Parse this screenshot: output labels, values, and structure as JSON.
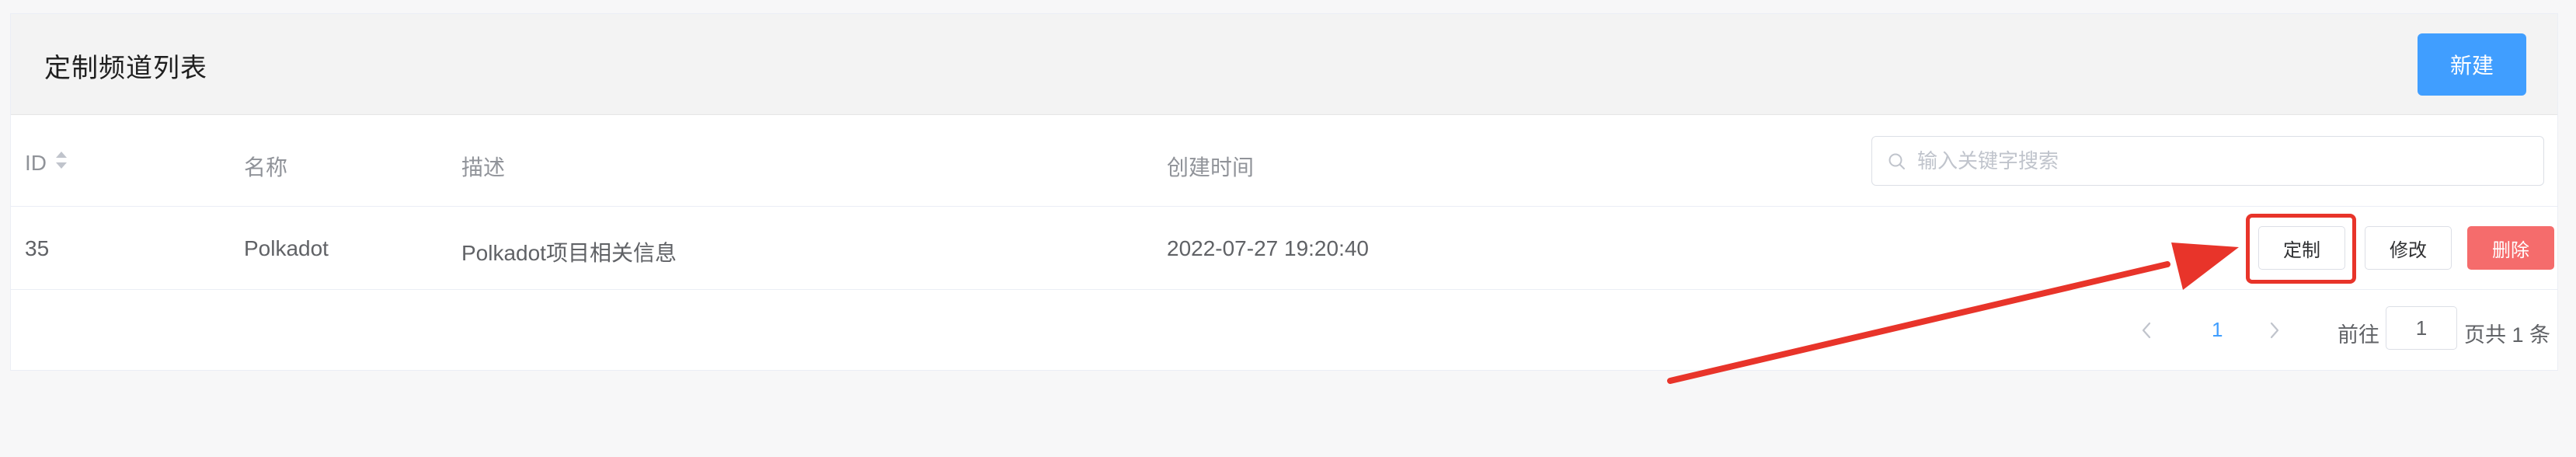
{
  "header": {
    "title": "定制频道列表",
    "new_button": "新建"
  },
  "table": {
    "columns": [
      "ID",
      "名称",
      "描述",
      "创建时间"
    ],
    "search_placeholder": "输入关键字搜索",
    "rows": [
      {
        "id": "35",
        "name": "Polkadot",
        "description": "Polkadot项目相关信息",
        "created_at": "2022-07-27 19:20:40",
        "actions": {
          "customize": "定制",
          "edit": "修改",
          "delete": "删除"
        }
      }
    ]
  },
  "pagination": {
    "prev": "<",
    "current_page": "1",
    "next": ">",
    "goto_label": "前往",
    "goto_value": "1",
    "total_label": "页共 1 条"
  },
  "colors": {
    "primary": "#409eff",
    "danger": "#f56c6c",
    "annotation": "#e8342a"
  },
  "icons": {
    "sort": "sort-caret-icon",
    "search": "search-icon",
    "annotation": "red-arrow-icon"
  }
}
